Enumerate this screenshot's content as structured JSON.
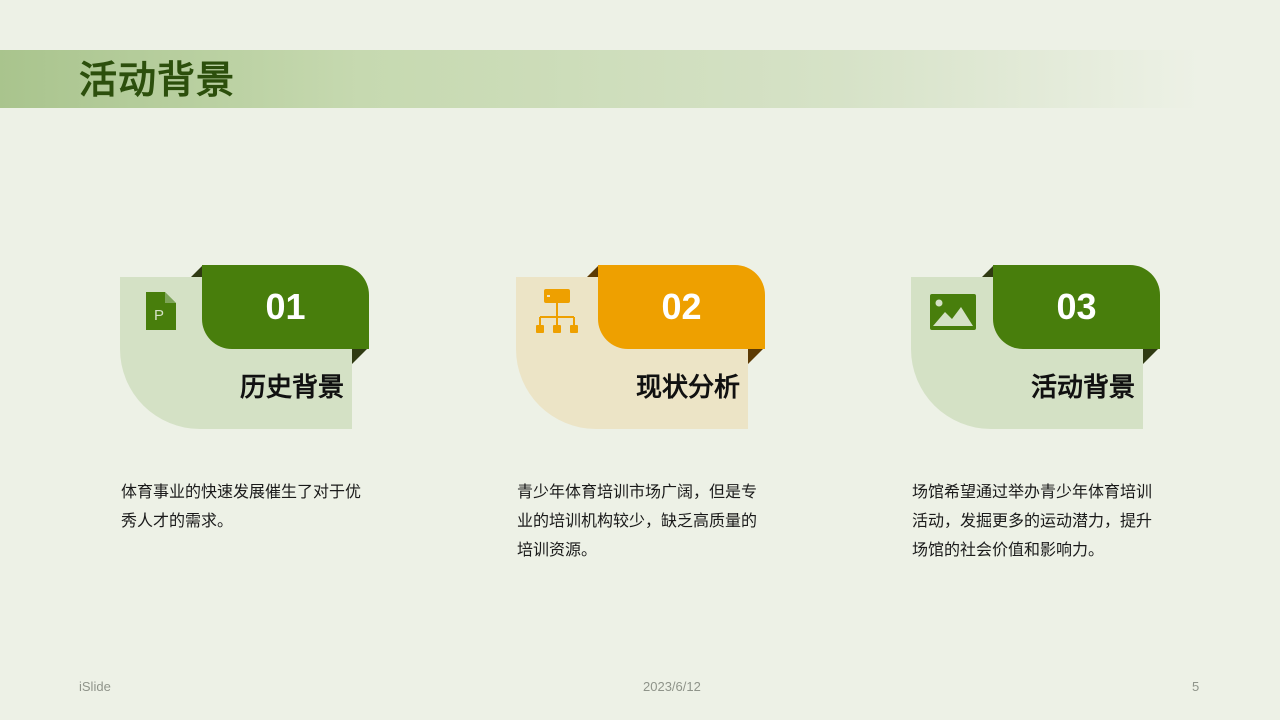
{
  "title": "活动背景",
  "accent_green": "#487e0c",
  "accent_orange": "#eea000",
  "cards": [
    {
      "number": "01",
      "label": "历史背景",
      "icon": "file-p-icon",
      "color": "#487e0c",
      "bg": "#d4e1c5",
      "description": "体育事业的快速发展催生了对于优秀人才的需求。"
    },
    {
      "number": "02",
      "label": "现状分析",
      "icon": "hierarchy-icon",
      "color": "#eea000",
      "bg": "#ece4c6",
      "description": "青少年体育培训市场广阔，但是专业的培训机构较少，缺乏高质量的培训资源。"
    },
    {
      "number": "03",
      "label": "活动背景",
      "icon": "image-icon",
      "color": "#487e0c",
      "bg": "#d4e1c5",
      "description": "场馆希望通过举办青少年体育培训活动，发掘更多的运动潜力，提升场馆的社会价值和影响力。"
    }
  ],
  "footer": {
    "left": "iSlide",
    "center": "2023/6/12",
    "page_number": "5"
  }
}
